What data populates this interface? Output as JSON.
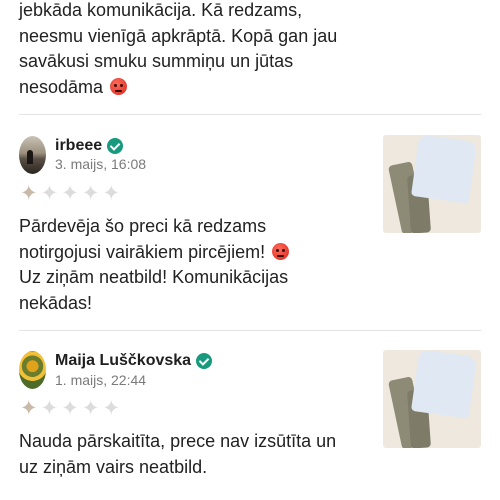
{
  "intro": {
    "lines": [
      "jebkāda komunikācija. Kā redzams,",
      "neesmu vienīgā apkrāptā. Kopā gan jau",
      "savākusi smuku summiņu un jūtas",
      "nesodāma"
    ],
    "emoji": "angry-face-emoji"
  },
  "reviews": [
    {
      "author": "irbeee",
      "verified_icon": "verified-check-icon",
      "date": "3. maijs, 16:08",
      "rating": 1,
      "rating_max": 5,
      "text_lines": [
        "Pārdevēja šo preci kā redzams",
        "notirgojusi vairākiem pircējiem!",
        "Uz ziņām neatbild! Komunikācijas",
        "nekādas!"
      ],
      "photo": "product-photo-shirt-and-trousers"
    },
    {
      "author": "Maija Luščkovska",
      "verified_icon": "verified-check-icon",
      "date": "1. maijs, 22:44",
      "rating": 1,
      "rating_max": 5,
      "text_lines": [
        "Nauda pārskaitīta, prece nav izsūtīta un",
        "uz ziņām vairs neatbild."
      ],
      "photo": "product-photo-shirt-and-trousers"
    }
  ],
  "colors": {
    "verified": "#179a7e",
    "divider": "#e4e4e4",
    "date": "#7a7a7a",
    "star_empty": "#dcdcdc",
    "star_filled": "#c9b9a8"
  }
}
